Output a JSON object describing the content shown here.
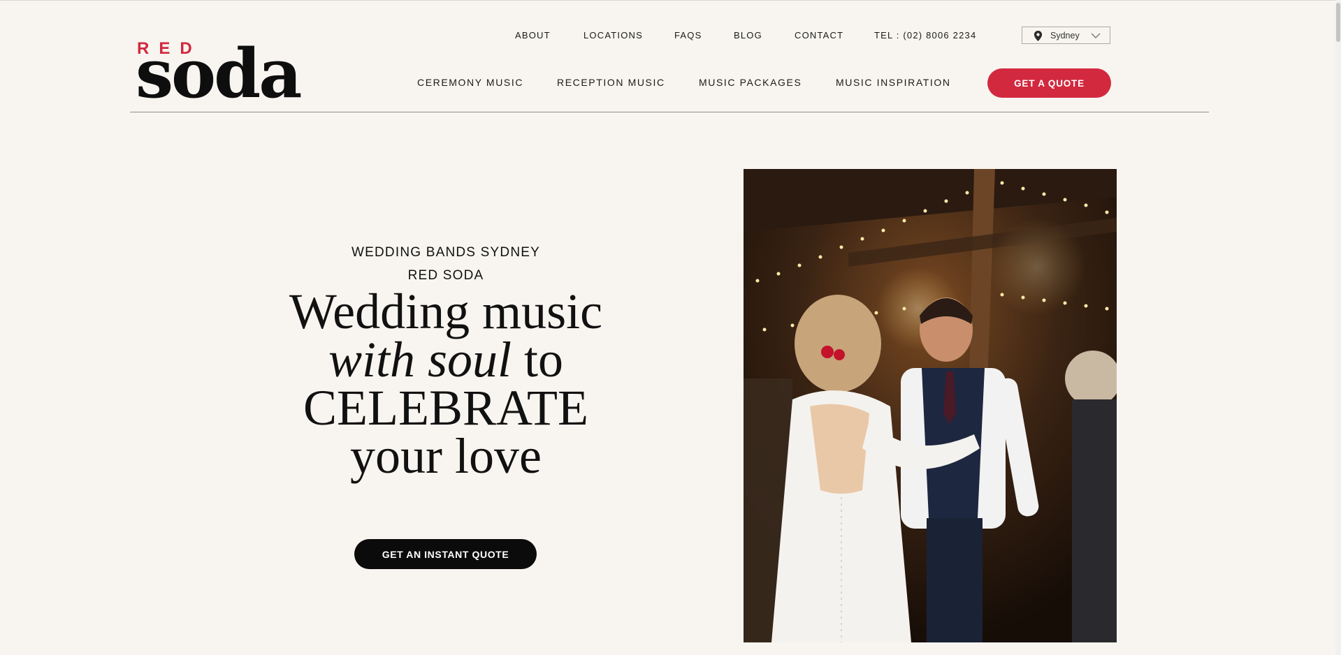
{
  "brand": {
    "red": "RED",
    "name": "soda",
    "accent_color": "#d2293f"
  },
  "top_nav": {
    "about": "ABOUT",
    "locations": "LOCATIONS",
    "faqs": "FAQS",
    "blog": "BLOG",
    "contact": "CONTACT",
    "phone": "TEL : (02) 8006 2234"
  },
  "location_select": {
    "icon": "map-pin-icon",
    "value": "Sydney",
    "chevron": "chevron-down-icon"
  },
  "main_nav": {
    "ceremony": "CEREMONY MUSIC",
    "reception": "RECEPTION MUSIC",
    "packages": "MUSIC PACKAGES",
    "inspiration": "MUSIC INSPIRATION",
    "quote_button": "GET A QUOTE"
  },
  "hero": {
    "eyebrow_1": "WEDDING BANDS SYDNEY",
    "eyebrow_2": "RED SODA",
    "title_line_1": "Wedding music",
    "title_line_2_italic": "with soul",
    "title_line_2_rest": " to",
    "title_line_3": "CELEBRATE",
    "title_line_4": "your love",
    "cta": "GET AN INSTANT QUOTE"
  },
  "colors": {
    "background": "#f8f5f0",
    "accent": "#d2293f",
    "cta_dark": "#0b0b0b"
  }
}
